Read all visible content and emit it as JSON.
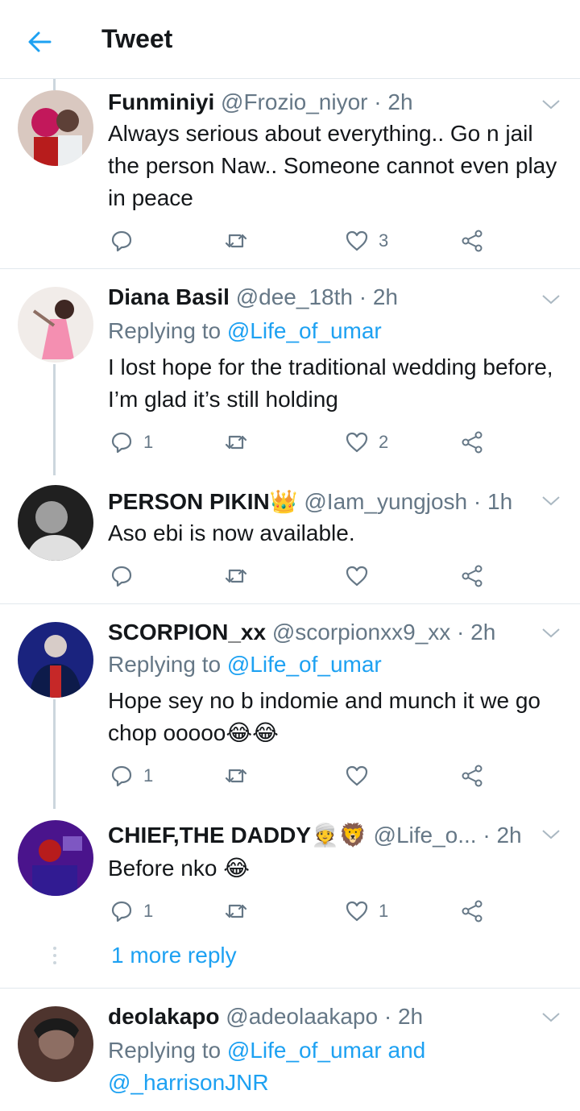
{
  "header": {
    "title": "Tweet",
    "back_icon": "arrow-left-icon",
    "accent": "#1da1f2"
  },
  "tweets": [
    {
      "name": "Funminiyi",
      "handle": "@Frozio_niyor",
      "time": "· 2h",
      "replying": null,
      "text": "Always serious about everything.. Go n jail the person Naw.. Someone cannot even play in peace",
      "replies": "",
      "retweets": "",
      "likes": "3"
    },
    {
      "name": "Diana Basil",
      "handle": "@dee_18th",
      "time": "· 2h",
      "replying_prefix": "Replying to",
      "replying_mention": "@Life_of_umar",
      "text": "I lost hope for the traditional wedding before, I’m glad it’s still holding",
      "replies": "1",
      "retweets": "",
      "likes": "2"
    },
    {
      "name": "PERSON PIKIN👑",
      "handle": "@Iam_yungjosh",
      "time": "· 1h",
      "text": "Aso ebi is now available.",
      "replies": "",
      "retweets": "",
      "likes": ""
    },
    {
      "name": "SCORPION_xx",
      "handle": "@scorpionxx9_xx",
      "time": "· 2h",
      "replying_prefix": "Replying to",
      "replying_mention": "@Life_of_umar",
      "text": "Hope sey no b indomie and munch it we go chop ooooo😂😂",
      "replies": "1",
      "retweets": "",
      "likes": ""
    },
    {
      "name": "CHIEF,THE DADDY👳🦁",
      "handle": "@Life_o...",
      "time": "· 2h",
      "text": "Before nko 😂",
      "replies": "1",
      "retweets": "",
      "likes": "1"
    },
    {
      "name": "deolakapo",
      "handle": "@adeolaakapo",
      "time": "· 2h",
      "replying_prefix": "Replying to",
      "replying_mention": "@Life_of_umar and",
      "replying_mention2": "@_harrisonJNR",
      "text": "",
      "replies": "",
      "retweets": "",
      "likes": ""
    }
  ],
  "more_reply": "1 more reply",
  "icons": [
    "reply-icon",
    "retweet-icon",
    "like-icon",
    "share-icon",
    "chevron-down-icon"
  ]
}
